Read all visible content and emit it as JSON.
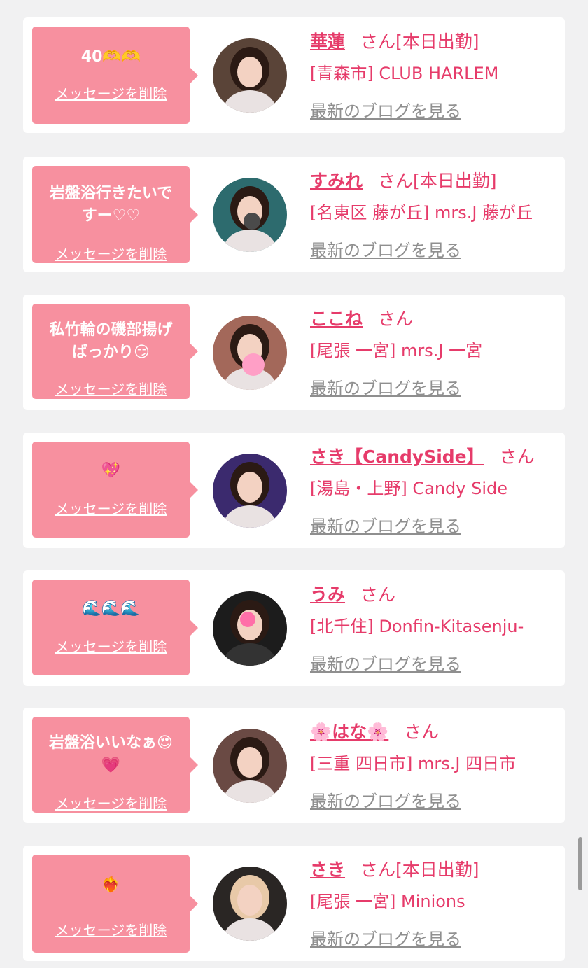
{
  "theme": {
    "accent": "#e63b6a",
    "bubble": "#f7909f",
    "background": "#f1f1f2",
    "card": "#ffffff",
    "muted_link": "#8f8f8f"
  },
  "entries": [
    {
      "message": "40🫶🫶",
      "delete_label": "メッセージを削除",
      "name": "華蓮",
      "honorific": "さん",
      "status": "[本日出勤]",
      "shop": "[青森市] CLUB HARLEM",
      "blog_label": "最新のブログを見る"
    },
    {
      "message": "岩盤浴行きたいで\nすー♡♡",
      "delete_label": "メッセージを削除",
      "name": "すみれ",
      "honorific": "さん",
      "status": "[本日出勤]",
      "shop": "[名東区 藤が丘] mrs.J 藤が丘",
      "blog_label": "最新のブログを見る"
    },
    {
      "message": "私竹輪の磯部揚げ\nばっかり😏",
      "delete_label": "メッセージを削除",
      "name": "ここね",
      "honorific": "さん",
      "status": "",
      "shop": "[尾張 一宮] mrs.J 一宮",
      "blog_label": "最新のブログを見る"
    },
    {
      "message": "💖",
      "delete_label": "メッセージを削除",
      "name": "さき【CandySide】",
      "honorific": "さん",
      "status": "",
      "shop": "[湯島・上野] Candy Side",
      "blog_label": "最新のブログを見る"
    },
    {
      "message": "🌊🌊🌊",
      "delete_label": "メッセージを削除",
      "name": "うみ",
      "honorific": "さん",
      "status": "",
      "shop": "[北千住] Donfin-Kitasenju-",
      "blog_label": "最新のブログを見る"
    },
    {
      "message": "岩盤浴いいなぁ😍\n💗",
      "delete_label": "メッセージを削除",
      "name": "🌸はな🌸",
      "honorific": "さん",
      "status": "",
      "shop": "[三重 四日市] mrs.J 四日市",
      "blog_label": "最新のブログを見る"
    },
    {
      "message": "❤️‍🔥",
      "delete_label": "メッセージを削除",
      "name": "さき",
      "honorific": "さん",
      "status": "[本日出勤]",
      "shop": "[尾張 一宮] Minions",
      "blog_label": "最新のブログを見る"
    }
  ],
  "avatars": [
    {
      "icon": "profile-photo-icon",
      "tone": "#5a4438"
    },
    {
      "icon": "profile-photo-icon",
      "tone": "#2d6b6e"
    },
    {
      "icon": "profile-photo-icon",
      "tone": "#a3685a"
    },
    {
      "icon": "profile-photo-icon",
      "tone": "#3b2a6e"
    },
    {
      "icon": "profile-photo-icon",
      "tone": "#1c1c1c"
    },
    {
      "icon": "profile-photo-icon",
      "tone": "#6a4a44"
    },
    {
      "icon": "profile-photo-icon",
      "tone": "#2a2624"
    }
  ]
}
